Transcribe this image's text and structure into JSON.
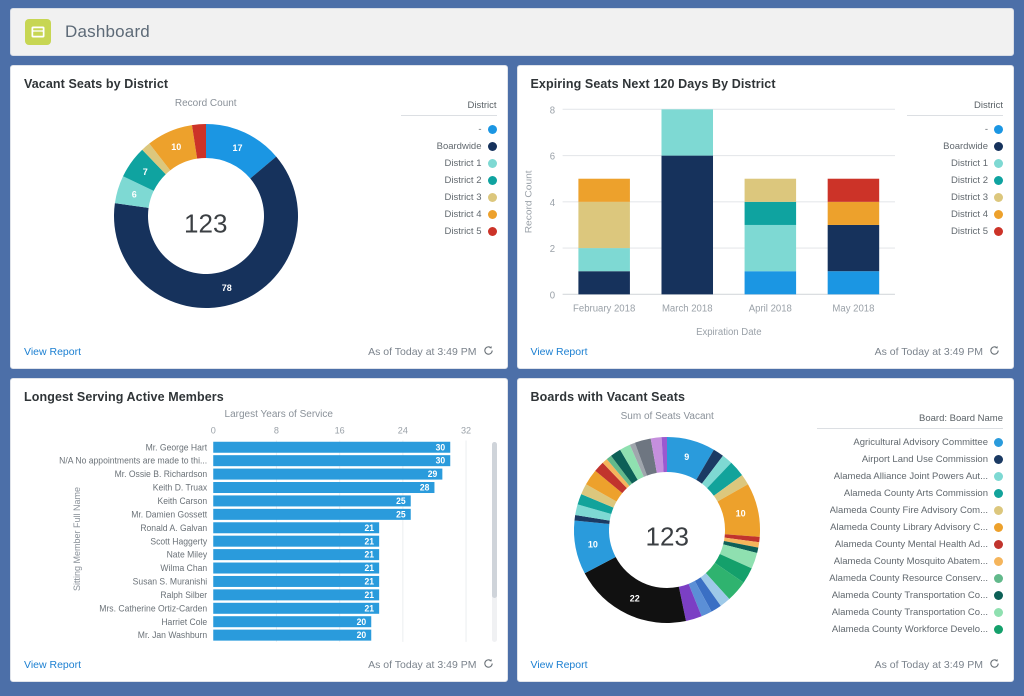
{
  "header": {
    "title": "Dashboard",
    "icon": "dashboard-icon",
    "icon_color": "#c7d653"
  },
  "footer_common": {
    "view_report": "View Report",
    "as_of": "As of Today at 3:49 PM",
    "refresh_icon": "refresh-icon"
  },
  "district_colors": {
    "dash": "#1b96e3",
    "boardwide": "#16325c",
    "d1": "#7ed9d3",
    "d2": "#0fa3a0",
    "d3": "#dcc77d",
    "d4": "#eda12c",
    "d5": "#cc3328"
  },
  "panels": {
    "vacant_seats": {
      "title": "Vacant Seats by District",
      "legend_title": "District"
    },
    "expiring_seats": {
      "title": "Expiring Seats Next 120 Days By District",
      "legend_title": "District"
    },
    "longest_serving": {
      "title": "Longest Serving Active Members"
    },
    "boards_vacant": {
      "title": "Boards with Vacant Seats",
      "legend_title": "Board: Board Name"
    }
  },
  "chart_data": [
    {
      "id": "vacant-seats-by-district",
      "type": "pie",
      "title": "Vacant Seats by District",
      "subtitle": "Record Count",
      "center_total": "123",
      "legend_title": "District",
      "legend_position": "right",
      "labels": [
        "-",
        "Boardwide",
        "District 1",
        "District 2",
        "District 3",
        "District 4",
        "District 5"
      ],
      "values": [
        17,
        78,
        6,
        7,
        2,
        10,
        3
      ],
      "shown_labels": [
        "17",
        "78",
        "6",
        "7",
        "",
        "10",
        ""
      ],
      "colors": [
        "#1b96e3",
        "#16325c",
        "#7ed9d3",
        "#0fa3a0",
        "#dcc77d",
        "#eda12c",
        "#cc3328"
      ]
    },
    {
      "id": "expiring-seats-next-120-days",
      "type": "bar",
      "title": "Expiring Seats Next 120 Days By District",
      "xlabel": "Expiration Date",
      "ylabel": "Record Count",
      "ylim": [
        0,
        8
      ],
      "yticks": [
        0,
        2,
        4,
        6,
        8
      ],
      "grid": true,
      "legend_title": "District",
      "legend_position": "right",
      "categories": [
        "February 2018",
        "March 2018",
        "April 2018",
        "May 2018"
      ],
      "series": [
        {
          "name": "-",
          "color": "#1b96e3",
          "values": [
            0,
            0,
            1,
            1
          ]
        },
        {
          "name": "Boardwide",
          "color": "#16325c",
          "values": [
            1,
            6,
            0,
            2
          ]
        },
        {
          "name": "District 1",
          "color": "#7ed9d3",
          "values": [
            1,
            2,
            2,
            0
          ]
        },
        {
          "name": "District 2",
          "color": "#0fa3a0",
          "values": [
            0,
            0,
            1,
            0
          ]
        },
        {
          "name": "District 3",
          "color": "#dcc77d",
          "values": [
            2,
            0,
            1,
            0
          ]
        },
        {
          "name": "District 4",
          "color": "#eda12c",
          "values": [
            1,
            0,
            0,
            1
          ]
        },
        {
          "name": "District 5",
          "color": "#cc3328",
          "values": [
            0,
            0,
            0,
            1
          ]
        }
      ]
    },
    {
      "id": "longest-serving-active-members",
      "type": "bar",
      "orientation": "horizontal",
      "title": "Longest Serving Active Members",
      "xlabel": "Largest Years of Service",
      "ylabel": "Sitting Member Full Name",
      "xlim": [
        0,
        32
      ],
      "xticks": [
        0,
        8,
        16,
        24,
        32
      ],
      "bar_color": "#2a9bdc",
      "categories": [
        "Mr. George Hart",
        "N/A No appointments are made to thi...",
        "Mr. Ossie B. Richardson",
        "Keith D. Truax",
        "Keith Carson",
        "Mr. Damien Gossett",
        "Ronald A. Galvan",
        "Scott Haggerty",
        "Nate Miley",
        "Wilma Chan",
        "Susan S. Muranishi",
        "Ralph Silber",
        "Mrs. Catherine Ortiz-Carden",
        "Harriet Cole",
        "Mr. Jan Washburn"
      ],
      "values": [
        30,
        30,
        29,
        28,
        25,
        25,
        21,
        21,
        21,
        21,
        21,
        21,
        21,
        20,
        20
      ]
    },
    {
      "id": "boards-with-vacant-seats",
      "type": "pie",
      "title": "Boards with Vacant Seats",
      "subtitle": "Sum of Seats Vacant",
      "center_total": "123",
      "legend_title": "Board: Board Name",
      "legend_position": "right",
      "legend_labels": [
        "Agricultural Advisory Committee",
        "Airport Land Use Commission",
        "Alameda Alliance Joint Powers Aut...",
        "Alameda County Arts Commission",
        "Alameda County Fire Advisory Com...",
        "Alameda County Library Advisory C...",
        "Alameda County Mental Health Ad...",
        "Alameda County Mosquito Abatem...",
        "Alameda County Resource Conserv...",
        "Alameda County Transportation Co...",
        "Alameda County Transportation Co...",
        "Alameda County Workforce Develo..."
      ],
      "legend_colors": [
        "#2a9bdc",
        "#1b3a63",
        "#7ed9d3",
        "#12a39b",
        "#dcc77d",
        "#eda12c",
        "#c1342d",
        "#f5b55c",
        "#62b98b",
        "#0d6057",
        "#8fe0b0",
        "#14a06b"
      ],
      "values": [
        9,
        2,
        2,
        3,
        2,
        10,
        1,
        1,
        1,
        3,
        3,
        4,
        2,
        2,
        2,
        3,
        22,
        10,
        1,
        2,
        2,
        2,
        3,
        2,
        1,
        1,
        2,
        2,
        1,
        3,
        2,
        1
      ],
      "colors": [
        "#2a9bdc",
        "#1b3a63",
        "#7ed9d3",
        "#12a39b",
        "#dcc77d",
        "#eda12c",
        "#c1342d",
        "#f5b55c",
        "#0d6057",
        "#8fe0b0",
        "#14a06b",
        "#2fb36f",
        "#9ec9e8",
        "#3a6fc4",
        "#5b8fd6",
        "#7b3fc4",
        "#111111",
        "#2a9bdc",
        "#1b3a63",
        "#7ed9d3",
        "#12a39b",
        "#dcc77d",
        "#eda12c",
        "#c1342d",
        "#f5b55c",
        "#62b98b",
        "#0d6057",
        "#8fe0b0",
        "#a0a6ad",
        "#6e7681",
        "#c58fdd",
        "#9b59d0"
      ],
      "shown_labels": {
        "9": "9",
        "10_right": "10",
        "22": "22",
        "10_left": "10"
      }
    }
  ]
}
